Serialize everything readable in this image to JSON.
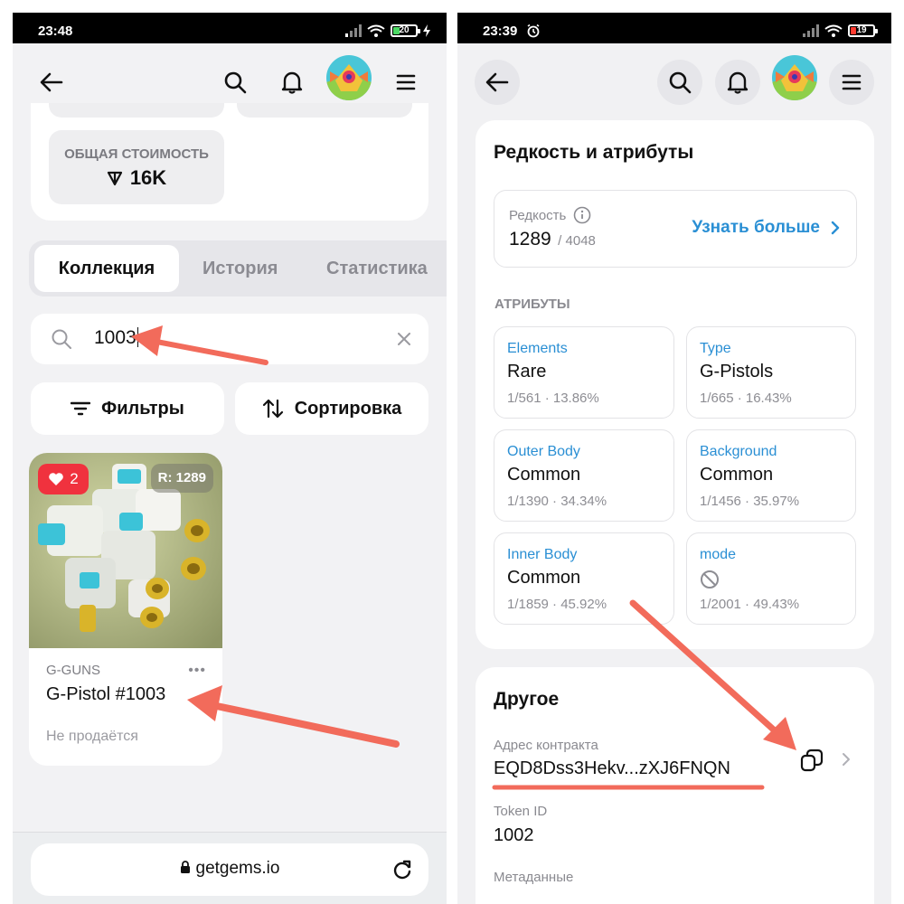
{
  "left": {
    "status": {
      "time": "23:48",
      "battery": "20"
    },
    "total": {
      "label": "ОБЩАЯ СТОИМОСТЬ",
      "value": "16K"
    },
    "tabs": [
      "Коллекция",
      "История",
      "Статистика"
    ],
    "search": {
      "value": "1003"
    },
    "buttons": {
      "filters": "Фильтры",
      "sort": "Сортировка"
    },
    "nft": {
      "likes": "2",
      "rank": "R: 1289",
      "collection": "G-GUNS",
      "name": "G-Pistol #1003",
      "more": "•••",
      "status": "Не продаётся"
    },
    "url": "getgems.io"
  },
  "right": {
    "status": {
      "time": "23:39",
      "battery": "19"
    },
    "rarity_section": {
      "title": "Редкость и атрибуты",
      "rarity_label": "Редкость",
      "rank": "1289",
      "total": "/ 4048",
      "learn_more": "Узнать больше"
    },
    "attributes_label": "АТРИБУТЫ",
    "attributes": [
      {
        "trait": "Elements",
        "value": "Rare",
        "stat": "1/561 · 13.86%"
      },
      {
        "trait": "Type",
        "value": "G-Pistols",
        "stat": "1/665 · 16.43%"
      },
      {
        "trait": "Outer Body",
        "value": "Common",
        "stat": "1/1390 · 34.34%"
      },
      {
        "trait": "Background",
        "value": "Common",
        "stat": "1/1456 · 35.97%"
      },
      {
        "trait": "Inner Body",
        "value": "Common",
        "stat": "1/1859 · 45.92%"
      },
      {
        "trait": "mode",
        "value": "",
        "stat": "1/2001 · 49.43%"
      }
    ],
    "other": {
      "title": "Другое",
      "contract_label": "Адрес контракта",
      "contract": "EQD8Dss3Hekv...zXJ6FNQN",
      "token_label": "Token ID",
      "token": "1002",
      "metadata_label": "Метаданные"
    }
  },
  "colors": {
    "accent": "#2a8fd4",
    "like": "#f0323e",
    "annotation": "#f26b5b"
  }
}
